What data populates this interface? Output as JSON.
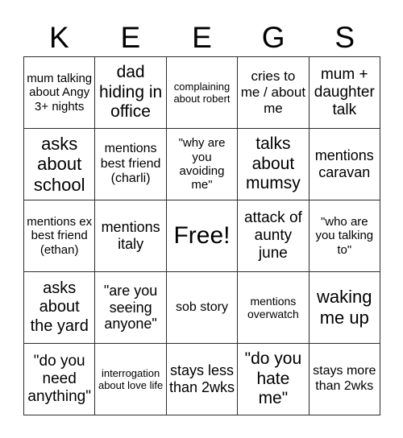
{
  "card": {
    "header_letters": [
      "K",
      "E",
      "E",
      "G",
      "S"
    ],
    "free_space_label": "Free!",
    "rows": [
      [
        {
          "text": "mum talking about Angy 3+ nights",
          "size": "fs-15"
        },
        {
          "text": "dad hiding in office",
          "size": "fs-21"
        },
        {
          "text": "complaining about robert",
          "size": "fs-13"
        },
        {
          "text": "cries to me / about me",
          "size": "fs-17"
        },
        {
          "text": "mum + daughter talk",
          "size": "fs-19"
        }
      ],
      [
        {
          "text": "asks about school",
          "size": "fs-22"
        },
        {
          "text": "mentions best friend (charli)",
          "size": "fs-16"
        },
        {
          "text": "\"why are you avoiding me\"",
          "size": "fs-15"
        },
        {
          "text": "talks about mumsy",
          "size": "fs-21"
        },
        {
          "text": "mentions caravan",
          "size": "fs-18"
        }
      ],
      [
        {
          "text": "mentions ex best friend (ethan)",
          "size": "fs-15"
        },
        {
          "text": "mentions italy",
          "size": "fs-18"
        },
        {
          "text": "Free!",
          "size": "fs-30"
        },
        {
          "text": "attack of aunty june",
          "size": "fs-19"
        },
        {
          "text": "\"who are you talking to\"",
          "size": "fs-15"
        }
      ],
      [
        {
          "text": "asks about the yard",
          "size": "fs-20"
        },
        {
          "text": "\"are you seeing anyone\"",
          "size": "fs-18"
        },
        {
          "text": "sob story",
          "size": "fs-26"
        },
        {
          "text": "mentions overwatch",
          "size": "fs-14"
        },
        {
          "text": "waking me up",
          "size": "fs-22"
        }
      ],
      [
        {
          "text": "\"do you need anything\"",
          "size": "fs-19"
        },
        {
          "text": "interrogation about love life",
          "size": "fs-13"
        },
        {
          "text": "stays less than 2wks",
          "size": "fs-18"
        },
        {
          "text": "\"do you hate me\"",
          "size": "fs-21"
        },
        {
          "text": "stays more than 2wks",
          "size": "fs-16"
        }
      ]
    ]
  }
}
